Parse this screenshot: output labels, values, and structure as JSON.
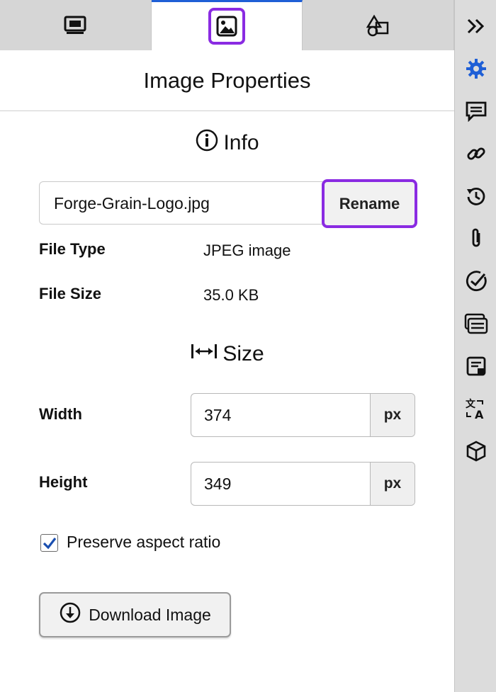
{
  "tabs": [
    {
      "icon": "monitor-icon",
      "active": false
    },
    {
      "icon": "image-icon",
      "active": true
    },
    {
      "icon": "shapes-icon",
      "active": false
    }
  ],
  "header": {
    "title": "Image Properties"
  },
  "info": {
    "title": "Info",
    "filename": "Forge-Grain-Logo.jpg",
    "rename_label": "Rename",
    "file_type_label": "File Type",
    "file_type_value": "JPEG image",
    "file_size_label": "File Size",
    "file_size_value": "35.0 KB"
  },
  "size": {
    "title": "Size",
    "width_label": "Width",
    "width_value": "374",
    "height_label": "Height",
    "height_value": "349",
    "unit": "px",
    "preserve_label": "Preserve aspect ratio",
    "preserve_checked": true
  },
  "download_label": "Download Image",
  "sidebar": {
    "items": [
      "collapse-icon",
      "settings-icon",
      "comment-icon",
      "link-icon",
      "history-icon",
      "attachment-icon",
      "check-circle-icon",
      "list-icon",
      "note-icon",
      "translate-icon",
      "cube-icon"
    ]
  },
  "colors": {
    "accent": "#8a2be2",
    "active_tab": "#1f5fd6",
    "settings_icon": "#1f5fd6"
  }
}
